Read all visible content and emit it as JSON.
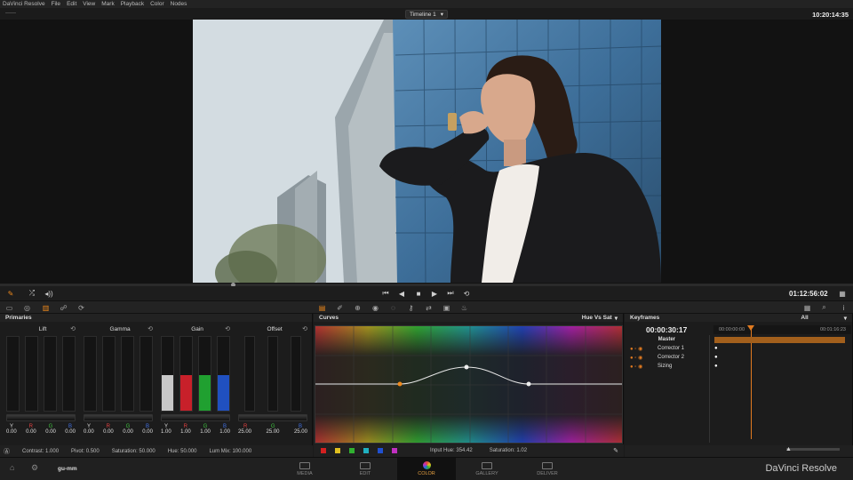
{
  "menu": [
    "DaVinci Resolve",
    "File",
    "Edit",
    "View",
    "Mark",
    "Playback",
    "Color",
    "Nodes"
  ],
  "timeline": {
    "label": "Timeline 1"
  },
  "clock": "10:20:14:35",
  "transport": {
    "timecode": "01:12:56:02"
  },
  "primaries": {
    "title": "Primaries",
    "wheels": [
      {
        "title": "Lift",
        "labels": [
          "Y",
          "R",
          "G",
          "B"
        ],
        "values": [
          "0.00",
          "0.00",
          "0.00",
          "0.00"
        ]
      },
      {
        "title": "Gamma",
        "labels": [
          "Y",
          "R",
          "G",
          "B"
        ],
        "values": [
          "0.00",
          "0.00",
          "0.00",
          "0.00"
        ]
      },
      {
        "title": "Gain",
        "labels": [
          "Y",
          "R",
          "G",
          "B"
        ],
        "values": [
          "1.00",
          "1.00",
          "1.00",
          "1.00"
        ]
      },
      {
        "title": "Offset",
        "labels": [
          "R",
          "G",
          "B"
        ],
        "values": [
          "25.00",
          "25.00",
          "25.00"
        ]
      }
    ],
    "status": {
      "contrast": "Contrast: 1.000",
      "pivot": "Pivot: 0.500",
      "saturation": "Saturation: 50.000",
      "hue": "Hue: 50.000",
      "lummix": "Lum Mix: 100.000"
    }
  },
  "curves": {
    "title": "Curves",
    "mode": "Hue Vs Sat",
    "input_hue": "Input Hue: 354.42",
    "saturation": "Saturation: 1.02",
    "swatches": [
      "#d42020",
      "#e0c020",
      "#30b030",
      "#20b0c0",
      "#2050d0",
      "#c030c0"
    ]
  },
  "keyframes": {
    "title": "Keyframes",
    "filter": "All",
    "current": "00:00:30:17",
    "tc_start": "00:00:00:00",
    "tc_end": "00:01:16:23",
    "tracks": [
      "Master",
      "Corrector 1",
      "Corrector 2",
      "Sizing"
    ]
  },
  "footer": {
    "user": "gu-mm",
    "pages": [
      "MEDIA",
      "EDIT",
      "COLOR",
      "GALLERY",
      "DELIVER"
    ],
    "brand": "DaVinci Resolve"
  },
  "colors": {
    "accent": "#f08a1c",
    "panel": "#1c1c1c"
  }
}
